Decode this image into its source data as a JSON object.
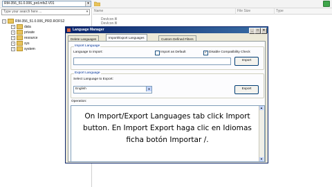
{
  "toolbar": {
    "path_value": "RM-356_51.0.006_prd.mfs2.V01",
    "folder_icon": "folder-icon",
    "action_icon": "green-action-icon",
    "action_color": "#3fa64a"
  },
  "tree": {
    "search_placeholder": "Type your search here ...",
    "root_label": "RM-356_51.0.006_PRD.ROFS2",
    "children": [
      "data",
      "private",
      "resource",
      "sys",
      "system"
    ]
  },
  "list": {
    "columns": [
      "Name",
      "File Size",
      "Type"
    ],
    "rows": [
      "DevIcon.fil",
      "DevIcon.fil"
    ]
  },
  "dialog": {
    "title": "Language Manager",
    "title_color": "#0a246a",
    "tabs": [
      "Delete Languages",
      "Import/Export Languages",
      "Custom Defined Filters"
    ],
    "active_tab_index": 1,
    "import": {
      "group_label": "Import Language",
      "field_label": "Language to import:",
      "field_value": "",
      "import_as_default_label": "Import as Default",
      "import_as_default_checked": false,
      "disable_compat_label": "Disable Compatibility Check",
      "disable_compat_checked": true,
      "button_label": "Import"
    },
    "export": {
      "group_label": "Export Language",
      "select_label": "Select Language to Export:",
      "selected_language": "English",
      "button_label": "Export"
    },
    "operation_label": "Operation:"
  },
  "caption": {
    "text": "On Import/Export Languages tab click Import button. En Import Export haga clic en Idiomas ficha botón Importar /."
  }
}
